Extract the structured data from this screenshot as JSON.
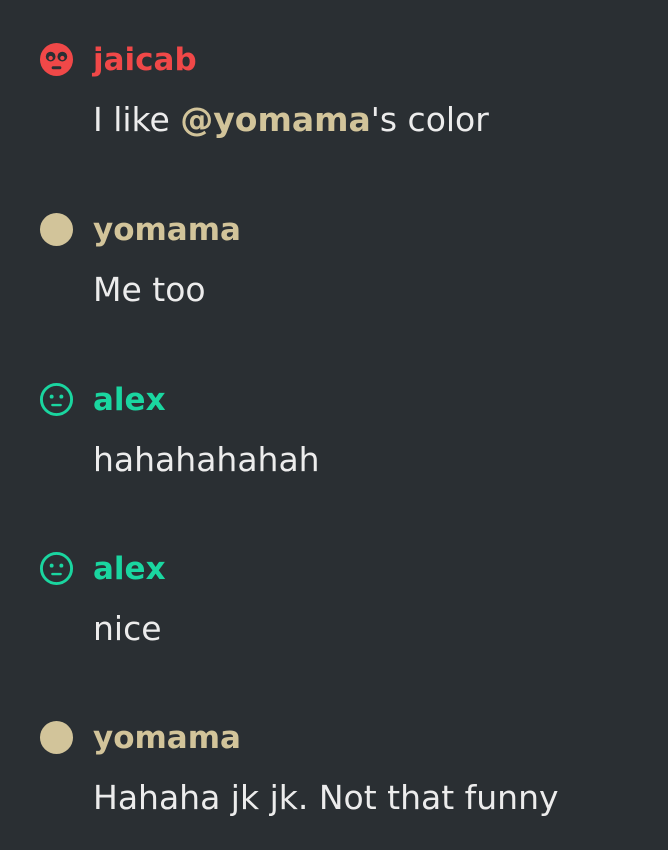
{
  "colors": {
    "background": "#2a2f33",
    "message_text": "#ececec",
    "jaicab": "#f04848",
    "yomama": "#d2c49a",
    "alex": "#1ad6a0"
  },
  "messages": [
    {
      "author": "jaicab",
      "color": "#f04848",
      "avatar_icon": "flushed-face-icon",
      "text_before": "I like ",
      "mention": "@yomama",
      "mention_color": "#d2c49a",
      "text_after": "'s color"
    },
    {
      "author": "yomama",
      "color": "#d2c49a",
      "avatar_icon": "filled-circle-icon",
      "text": "Me too"
    },
    {
      "author": "alex",
      "color": "#1ad6a0",
      "avatar_icon": "neutral-face-icon",
      "text": "hahahahahah"
    },
    {
      "author": "alex",
      "color": "#1ad6a0",
      "avatar_icon": "neutral-face-icon",
      "text": "nice"
    },
    {
      "author": "yomama",
      "color": "#d2c49a",
      "avatar_icon": "filled-circle-icon",
      "text": "Hahaha jk jk. Not that funny"
    }
  ]
}
